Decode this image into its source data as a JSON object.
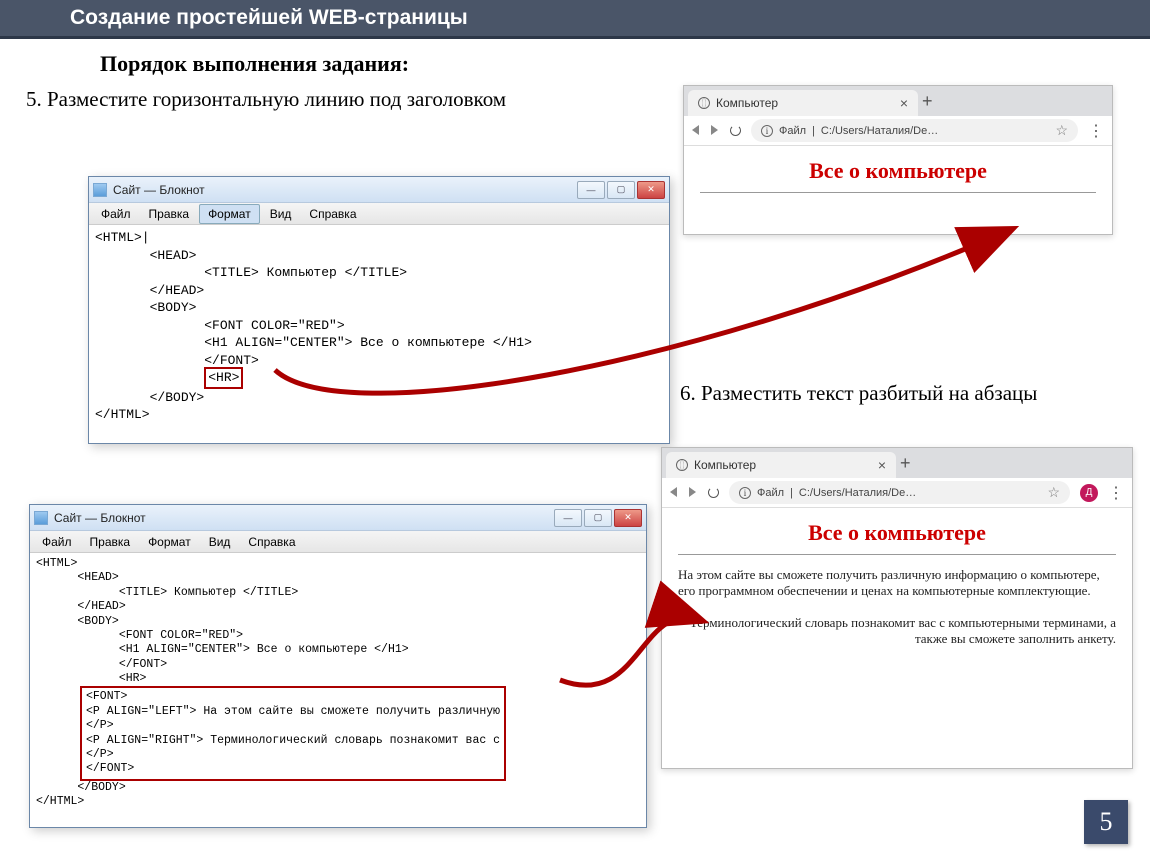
{
  "header": {
    "title": "Создание простейшей WEB-страницы"
  },
  "subtitle": "Порядок выполнения задания:",
  "step5": {
    "num": "5.",
    "text": "Разместите горизонтальную линию под заголовком"
  },
  "step6": {
    "num": "6.",
    "text": "Разместить текст разбитый на абзацы"
  },
  "notepad_top": {
    "title": "Сайт — Блокнот",
    "menu": [
      "Файл",
      "Правка",
      "Формат",
      "Вид",
      "Справка"
    ],
    "lines": [
      "<HTML>|",
      "       <HEAD>",
      "              <TITLE> Компьютер </TITLE>",
      "       </HEAD>",
      "       <BODY>",
      "              <FONT COLOR=\"RED\">",
      "              <H1 ALIGN=\"CENTER\"> Все о компьютере </H1>",
      "              </FONT>",
      "       </BODY>",
      "</HTML>"
    ],
    "hr_tag": "<HR>"
  },
  "notepad_bottom": {
    "title": "Сайт — Блокнот",
    "menu": [
      "Файл",
      "Правка",
      "Формат",
      "Вид",
      "Справка"
    ],
    "pre": "<HTML>\n      <HEAD>\n            <TITLE> Компьютер </TITLE>\n      </HEAD>\n      <BODY>\n            <FONT COLOR=\"RED\">\n            <H1 ALIGN=\"CENTER\"> Все о компьютере </H1>\n            </FONT>\n            <HR>",
    "font_block": "<FONT>\n<P ALIGN=\"LEFT\"> На этом сайте вы сможете получить различную\n</P>\n<P ALIGN=\"RIGHT\"> Терминологический словарь познакомит вас с\n</P>\n</FONT>",
    "post": "      </BODY>\n</HTML>"
  },
  "browser1": {
    "tab": "Компьютер",
    "url_label": "Файл",
    "url_path": "C:/Users/Наталия/De…",
    "heading": "Все о компьютере"
  },
  "browser2": {
    "tab": "Компьютер",
    "url_label": "Файл",
    "url_path": "C:/Users/Наталия/De…",
    "avatar": "Д",
    "heading": "Все о компьютере",
    "para1": "На этом сайте вы сможете получить различную информацию о компьютере, его программном обеспечении и ценах на компьютерные комплектующие.",
    "para2": "Терминологический словарь познакомит вас с компьютерными терминами, а также вы сможете заполнить анкету."
  },
  "page_number": "5"
}
